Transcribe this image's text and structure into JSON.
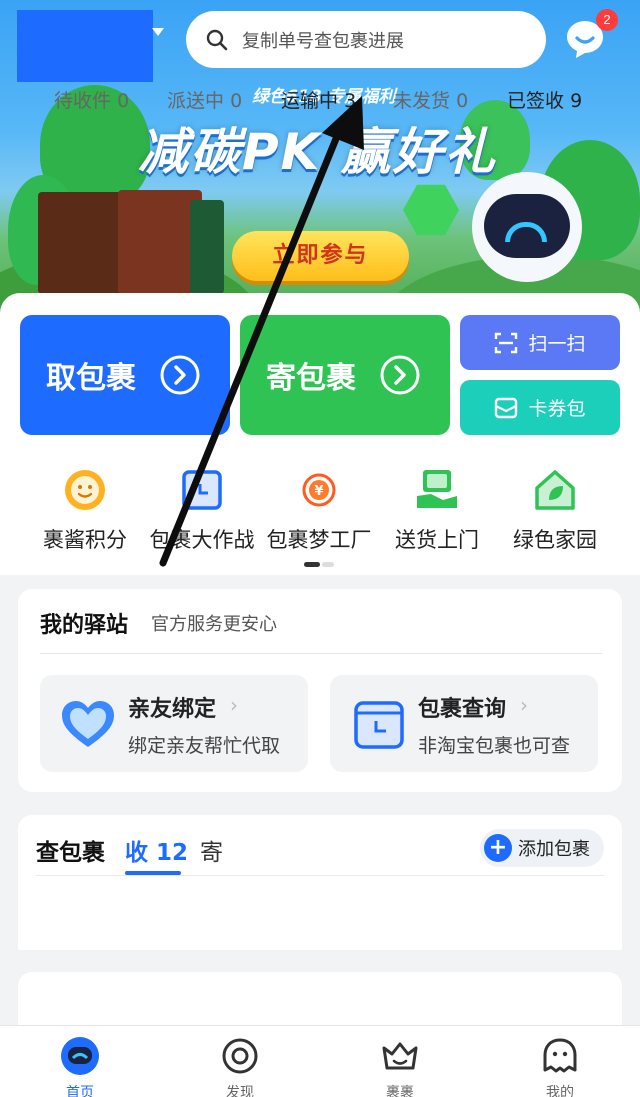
{
  "header": {
    "search_placeholder": "复制单号查包裹进展",
    "message_badge": "2"
  },
  "banner": {
    "subtitle": "绿色618 专属福利",
    "title": "减碳PK 赢好礼",
    "cta": "立即参与"
  },
  "actions": {
    "pickup": "取包裹",
    "send": "寄包裹",
    "scan": "扫一扫",
    "coupons": "卡券包"
  },
  "shortcuts": [
    {
      "label": "裹酱积分",
      "icon": "smile-icon"
    },
    {
      "label": "包裹大作战",
      "icon": "calendar-box-icon"
    },
    {
      "label": "包裹梦工厂",
      "icon": "coin-icon"
    },
    {
      "label": "送货上门",
      "icon": "delivery-box-icon"
    },
    {
      "label": "绿色家园",
      "icon": "green-home-icon"
    }
  ],
  "station": {
    "title": "我的驿站",
    "subtitle": "官方服务更安心",
    "tiles": [
      {
        "title": "亲友绑定",
        "desc": "绑定亲友帮忙代取"
      },
      {
        "title": "包裹查询",
        "desc": "非淘宝包裹也可查"
      }
    ]
  },
  "packages": {
    "title": "查包裹",
    "tab_receive": "收 12",
    "tab_send": "寄",
    "add_button": "添加包裹",
    "statuses": [
      {
        "label": "待收件",
        "count": "0"
      },
      {
        "label": "派送中",
        "count": "0"
      },
      {
        "label": "运输中",
        "count": "3"
      },
      {
        "label": "未发货",
        "count": "0"
      },
      {
        "label": "已签收",
        "count": "9"
      }
    ]
  },
  "nav": {
    "home": "首页",
    "discover": "发现",
    "guoguo": "裹裹",
    "mine": "我的"
  },
  "colors": {
    "primary_blue": "#1e6bff",
    "green": "#2ec353",
    "purple_blue": "#5b79f4",
    "teal": "#1ccfbb",
    "badge_red": "#ff3b3b"
  }
}
